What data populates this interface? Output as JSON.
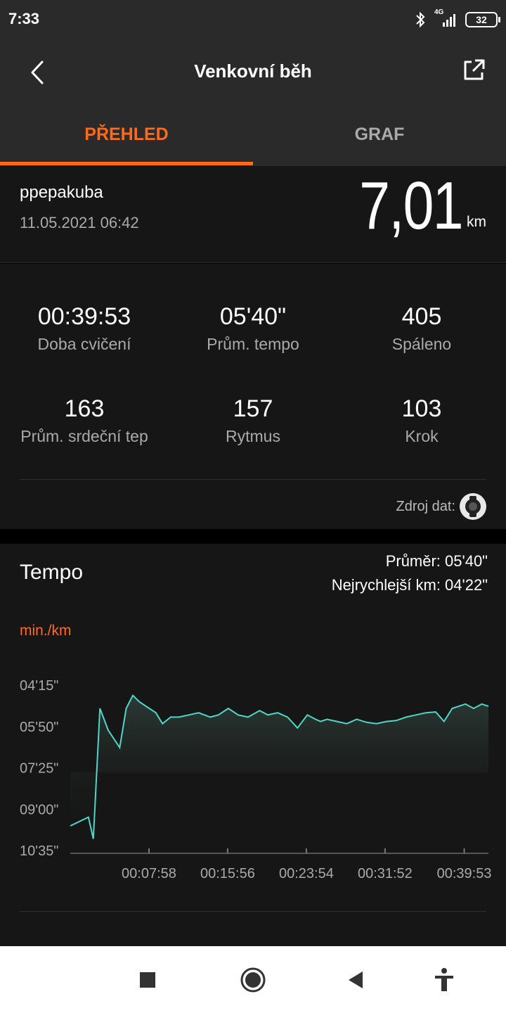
{
  "status_bar": {
    "time": "7:33",
    "network": "4G",
    "battery": "32"
  },
  "header": {
    "title": "Venkovní běh",
    "tabs": [
      {
        "label": "PŘEHLED",
        "active": true
      },
      {
        "label": "GRAF",
        "active": false
      }
    ]
  },
  "summary": {
    "username": "ppepakuba",
    "datetime": "11.05.2021 06:42",
    "distance": "7,01",
    "distance_unit": "km"
  },
  "stats": [
    {
      "value": "00:39:53",
      "label": "Doba cvičení"
    },
    {
      "value": "05'40\"",
      "label": "Prům. tempo"
    },
    {
      "value": "405",
      "label": "Spáleno"
    },
    {
      "value": "163",
      "label": "Prům. srdeční tep"
    },
    {
      "value": "157",
      "label": "Rytmus"
    },
    {
      "value": "103",
      "label": "Krok"
    }
  ],
  "data_source": {
    "label": "Zdroj dat:",
    "icon": "watch-icon"
  },
  "pace": {
    "title": "Tempo",
    "average": "Průměr: 05'40\"",
    "fastest": "Nejrychlejší km: 04'22\"",
    "unit": "min./km"
  },
  "chart_data": {
    "type": "area",
    "title": "",
    "xlabel": "",
    "ylabel": "min./km",
    "y_axis_inverted": true,
    "y_ticks": [
      "04'15\"",
      "05'50\"",
      "07'25\"",
      "09'00\"",
      "10'35\""
    ],
    "x_ticks": [
      "00:07:58",
      "00:15:56",
      "00:23:54",
      "00:31:52",
      "00:39:53"
    ],
    "ylim_seconds": [
      255,
      635
    ],
    "xlim_seconds": [
      0,
      2540
    ],
    "line_color": "#4fd6c8",
    "series": [
      {
        "x_seconds": [
          0,
          110,
          140,
          180,
          230,
          300,
          340,
          380,
          420,
          480,
          520,
          560,
          610,
          660,
          720,
          780,
          850,
          900,
          960,
          1020,
          1080,
          1150,
          1200,
          1260,
          1320,
          1380,
          1440,
          1490,
          1520,
          1560,
          1620,
          1680,
          1740,
          1800,
          1860,
          1920,
          1980,
          2040,
          2100,
          2160,
          2220,
          2270,
          2320,
          2360,
          2400,
          2450,
          2500,
          2540
        ],
        "pace_seconds": [
          580,
          560,
          610,
          310,
          360,
          400,
          310,
          280,
          295,
          310,
          320,
          345,
          330,
          330,
          325,
          320,
          330,
          325,
          310,
          325,
          330,
          315,
          325,
          320,
          330,
          355,
          325,
          335,
          340,
          335,
          340,
          345,
          335,
          342,
          345,
          340,
          338,
          330,
          325,
          320,
          318,
          340,
          310,
          305,
          300,
          310,
          300,
          305
        ]
      }
    ]
  },
  "nav_bar": {
    "buttons": [
      "recent-apps-icon",
      "home-icon",
      "back-icon",
      "accessibility-icon"
    ]
  }
}
